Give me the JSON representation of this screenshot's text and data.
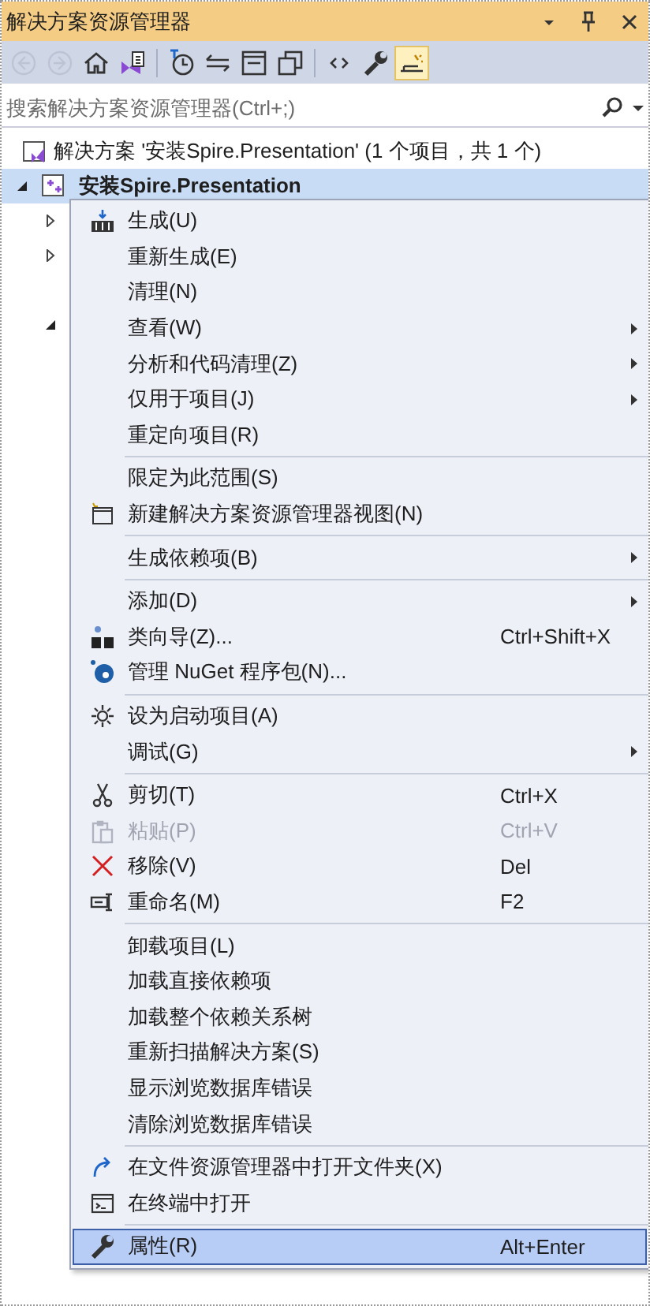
{
  "window": {
    "title": "解决方案资源管理器"
  },
  "toolbar": {
    "buttons": [
      {
        "disabled": true,
        "selected": false
      },
      {
        "disabled": true,
        "selected": false
      },
      {
        "disabled": false,
        "selected": false
      },
      {
        "disabled": false,
        "selected": false
      },
      {
        "disabled": false,
        "selected": false
      },
      {
        "disabled": false,
        "selected": false
      },
      {
        "disabled": false,
        "selected": false
      },
      {
        "disabled": false,
        "selected": false
      },
      {
        "disabled": false,
        "selected": false
      },
      {
        "disabled": false,
        "selected": false
      },
      {
        "disabled": false,
        "selected": true
      }
    ]
  },
  "search": {
    "placeholder": "搜索解决方案资源管理器(Ctrl+;)"
  },
  "tree": {
    "solution": "解决方案 '安装Spire.Presentation' (1 个项目，共 1 个)",
    "project": {
      "label": "安装Spire.Presentation",
      "selected": true,
      "expanded": true,
      "children": [
        {
          "kind": "node",
          "expanded": false
        },
        {
          "kind": "node",
          "expanded": false
        },
        {
          "kind": "leaf"
        },
        {
          "kind": "node",
          "expanded": true
        }
      ]
    }
  },
  "menu": {
    "groups": [
      [
        {
          "label": "生成(U)",
          "disabled": false,
          "selected": false,
          "submenu": false
        },
        {
          "label": "重新生成(E)",
          "disabled": false,
          "selected": false,
          "submenu": false
        },
        {
          "label": "清理(N)",
          "disabled": false,
          "selected": false,
          "submenu": false
        },
        {
          "label": "查看(W)",
          "disabled": false,
          "selected": false,
          "submenu": true
        },
        {
          "label": "分析和代码清理(Z)",
          "disabled": false,
          "selected": false,
          "submenu": true
        },
        {
          "label": "仅用于项目(J)",
          "disabled": false,
          "selected": false,
          "submenu": true
        },
        {
          "label": "重定向项目(R)",
          "disabled": false,
          "selected": false,
          "submenu": false
        }
      ],
      [
        {
          "label": "限定为此范围(S)",
          "disabled": false,
          "selected": false,
          "submenu": false
        },
        {
          "label": "新建解决方案资源管理器视图(N)",
          "disabled": false,
          "selected": false,
          "submenu": false
        }
      ],
      [
        {
          "label": "生成依赖项(B)",
          "disabled": false,
          "selected": false,
          "submenu": true
        }
      ],
      [
        {
          "label": "添加(D)",
          "disabled": false,
          "selected": false,
          "submenu": true
        },
        {
          "label": "类向导(Z)...",
          "shortcut": "Ctrl+Shift+X",
          "disabled": false,
          "selected": false,
          "submenu": false
        },
        {
          "label": "管理 NuGet 程序包(N)...",
          "disabled": false,
          "selected": false,
          "submenu": false
        }
      ],
      [
        {
          "label": "设为启动项目(A)",
          "disabled": false,
          "selected": false,
          "submenu": false
        },
        {
          "label": "调试(G)",
          "disabled": false,
          "selected": false,
          "submenu": true
        }
      ],
      [
        {
          "label": "剪切(T)",
          "shortcut": "Ctrl+X",
          "disabled": false,
          "selected": false,
          "submenu": false
        },
        {
          "label": "粘贴(P)",
          "shortcut": "Ctrl+V",
          "disabled": true,
          "selected": false,
          "submenu": false
        },
        {
          "label": "移除(V)",
          "shortcut": "Del",
          "disabled": false,
          "selected": false,
          "submenu": false
        },
        {
          "label": "重命名(M)",
          "shortcut": "F2",
          "disabled": false,
          "selected": false,
          "submenu": false
        }
      ],
      [
        {
          "label": "卸载项目(L)",
          "disabled": false,
          "selected": false,
          "submenu": false
        },
        {
          "label": "加载直接依赖项",
          "disabled": false,
          "selected": false,
          "submenu": false
        },
        {
          "label": "加载整个依赖关系树",
          "disabled": false,
          "selected": false,
          "submenu": false
        },
        {
          "label": "重新扫描解决方案(S)",
          "disabled": false,
          "selected": false,
          "submenu": false
        },
        {
          "label": "显示浏览数据库错误",
          "disabled": false,
          "selected": false,
          "submenu": false
        },
        {
          "label": "清除浏览数据库错误",
          "disabled": false,
          "selected": false,
          "submenu": false
        }
      ],
      [
        {
          "label": "在文件资源管理器中打开文件夹(X)",
          "disabled": false,
          "selected": false,
          "submenu": false
        },
        {
          "label": "在终端中打开",
          "disabled": false,
          "selected": false,
          "submenu": false
        }
      ],
      [
        {
          "label": "属性(R)",
          "shortcut": "Alt+Enter",
          "disabled": false,
          "selected": true,
          "submenu": false
        }
      ]
    ]
  }
}
